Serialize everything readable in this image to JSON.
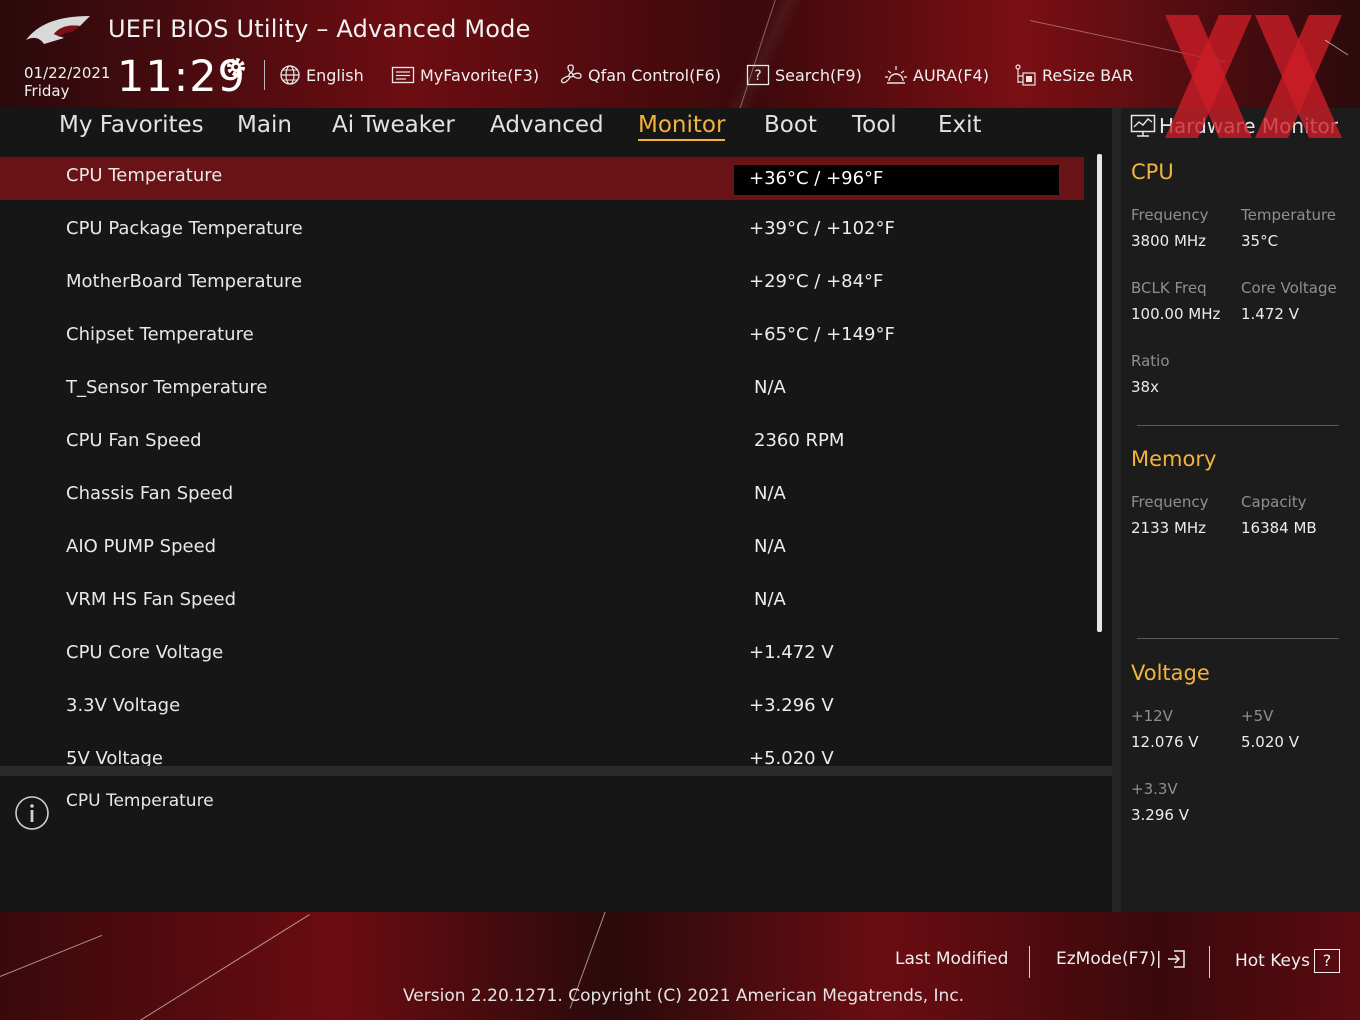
{
  "header": {
    "title": "UEFI BIOS Utility – Advanced Mode",
    "date": "01/22/2021",
    "day": "Friday",
    "time": "11:29",
    "toolbar": {
      "language": "English",
      "favorite": "MyFavorite(F3)",
      "qfan": "Qfan Control(F6)",
      "search": "Search(F9)",
      "aura": "AURA(F4)",
      "resize_bar": "ReSize BAR"
    }
  },
  "nav": {
    "tabs": [
      {
        "label": "My Favorites"
      },
      {
        "label": "Main"
      },
      {
        "label": "Ai Tweaker"
      },
      {
        "label": "Advanced"
      },
      {
        "label": "Monitor"
      },
      {
        "label": "Boot"
      },
      {
        "label": "Tool"
      },
      {
        "label": "Exit"
      }
    ],
    "active": "Monitor"
  },
  "settings": [
    {
      "label": "CPU Temperature",
      "value": "+36°C / +96°F"
    },
    {
      "label": "CPU Package Temperature",
      "value": "+39°C / +102°F"
    },
    {
      "label": "MotherBoard Temperature",
      "value": "+29°C / +84°F"
    },
    {
      "label": "Chipset Temperature",
      "value": "+65°C / +149°F"
    },
    {
      "label": "T_Sensor Temperature",
      "value": "N/A"
    },
    {
      "label": "CPU Fan Speed",
      "value": "2360 RPM"
    },
    {
      "label": "Chassis Fan Speed",
      "value": "N/A"
    },
    {
      "label": "AIO PUMP Speed",
      "value": "N/A"
    },
    {
      "label": "VRM HS Fan Speed",
      "value": "N/A"
    },
    {
      "label": "CPU Core Voltage",
      "value": "+1.472 V"
    },
    {
      "label": "3.3V Voltage",
      "value": "+3.296 V"
    },
    {
      "label": "5V Voltage",
      "value": "+5.020 V"
    }
  ],
  "help": {
    "text": "CPU Temperature"
  },
  "hardware_monitor": {
    "title": "Hardware Monitor",
    "cpu": {
      "heading": "CPU",
      "frequency_label": "Frequency",
      "frequency": "3800 MHz",
      "temperature_label": "Temperature",
      "temperature": "35°C",
      "bclk_label": "BCLK Freq",
      "bclk": "100.00 MHz",
      "core_voltage_label": "Core Voltage",
      "core_voltage": "1.472 V",
      "ratio_label": "Ratio",
      "ratio": "38x"
    },
    "memory": {
      "heading": "Memory",
      "frequency_label": "Frequency",
      "frequency": "2133 MHz",
      "capacity_label": "Capacity",
      "capacity": "16384 MB"
    },
    "voltage": {
      "heading": "Voltage",
      "v12_label": "+12V",
      "v12": "12.076 V",
      "v5_label": "+5V",
      "v5": "5.020 V",
      "v33_label": "+3.3V",
      "v33": "3.296 V"
    }
  },
  "footer": {
    "last_modified": "Last Modified",
    "ezmode": "EzMode(F7)|",
    "hotkeys": "Hot Keys",
    "hotkeys_key": "?",
    "version": "Version 2.20.1271. Copyright (C) 2021 American Megatrends, Inc."
  },
  "colors": {
    "accent": "#f3b23c",
    "selected_row": "#6a1316",
    "header_red": "#6d0d12"
  }
}
